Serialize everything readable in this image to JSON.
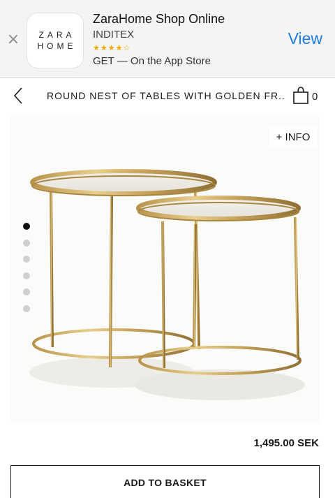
{
  "app_banner": {
    "close_glyph": "×",
    "icon_line1": "ZARA",
    "icon_line2": "HOME",
    "app_name": "ZaraHome Shop Online",
    "developer": "INDITEX",
    "rating": 4.5,
    "rating_stars": "★★★★☆",
    "get_text": "GET — On the App Store",
    "view_label": "View",
    "accent_color": "#1f7ae0"
  },
  "product_header": {
    "back_icon": "chevron-left-icon",
    "title": "ROUND NEST OF TABLES WITH GOLDEN FR...",
    "bag_icon": "shopping-bag-icon",
    "bag_count": "0"
  },
  "gallery": {
    "info_label": "+ INFO",
    "image_alt": "Round nest of tables with golden frame",
    "image_count": 6,
    "active_index": 0
  },
  "purchase": {
    "price": "1,495.00 SEK",
    "add_to_basket_label": "ADD TO BASKET"
  }
}
